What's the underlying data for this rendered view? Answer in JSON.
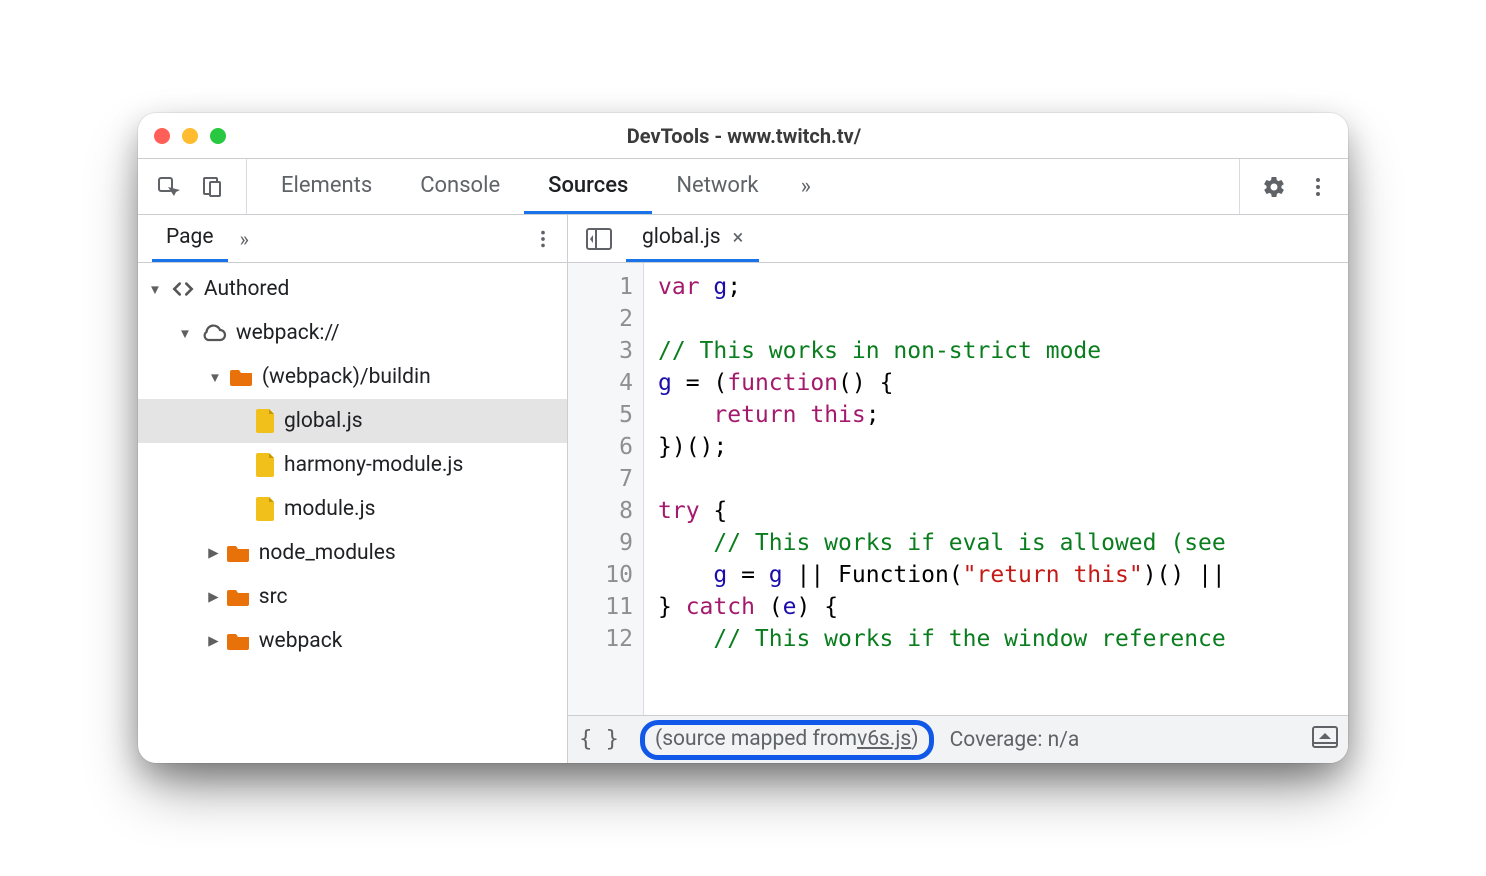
{
  "window": {
    "title": "DevTools - www.twitch.tv/"
  },
  "toolbar": {
    "tabs": [
      "Elements",
      "Console",
      "Sources",
      "Network"
    ],
    "active_tab_index": 2
  },
  "sidebar": {
    "active_tab": "Page",
    "tree": {
      "root_label": "Authored",
      "origin_label": "webpack://",
      "open_folder_label": "(webpack)/buildin",
      "files": [
        "global.js",
        "harmony-module.js",
        "module.js"
      ],
      "selected_file_index": 0,
      "collapsed_folders": [
        "node_modules",
        "src",
        "webpack"
      ]
    }
  },
  "editor": {
    "open_file": "global.js",
    "lines": [
      "1",
      "2",
      "3",
      "4",
      "5",
      "6",
      "7",
      "8",
      "9",
      "10",
      "11",
      "12"
    ],
    "code_html": [
      "<span class='kw'>var</span> <span class='id'>g</span>;",
      "",
      "<span class='cm'>// This works in non-strict mode</span>",
      "<span class='id'>g</span> = (<span class='kw'>function</span>() {",
      "    <span class='kw'>return</span> <span class='kw'>this</span>;",
      "})();",
      "",
      "<span class='kw'>try</span> {",
      "    <span class='cm'>// This works if eval is allowed (see</span>",
      "    <span class='id'>g</span> = <span class='id'>g</span> || Function(<span class='str'>\"return this\"</span>)() ||",
      "} <span class='kw'>catch</span> (<span class='id'>e</span>) {",
      "    <span class='cm'>// This works if the window reference</span>"
    ]
  },
  "statusbar": {
    "source_mapped_prefix": "(source mapped from ",
    "source_mapped_link": "v6s.js",
    "source_mapped_suffix": ")",
    "coverage": "Coverage: n/a"
  }
}
